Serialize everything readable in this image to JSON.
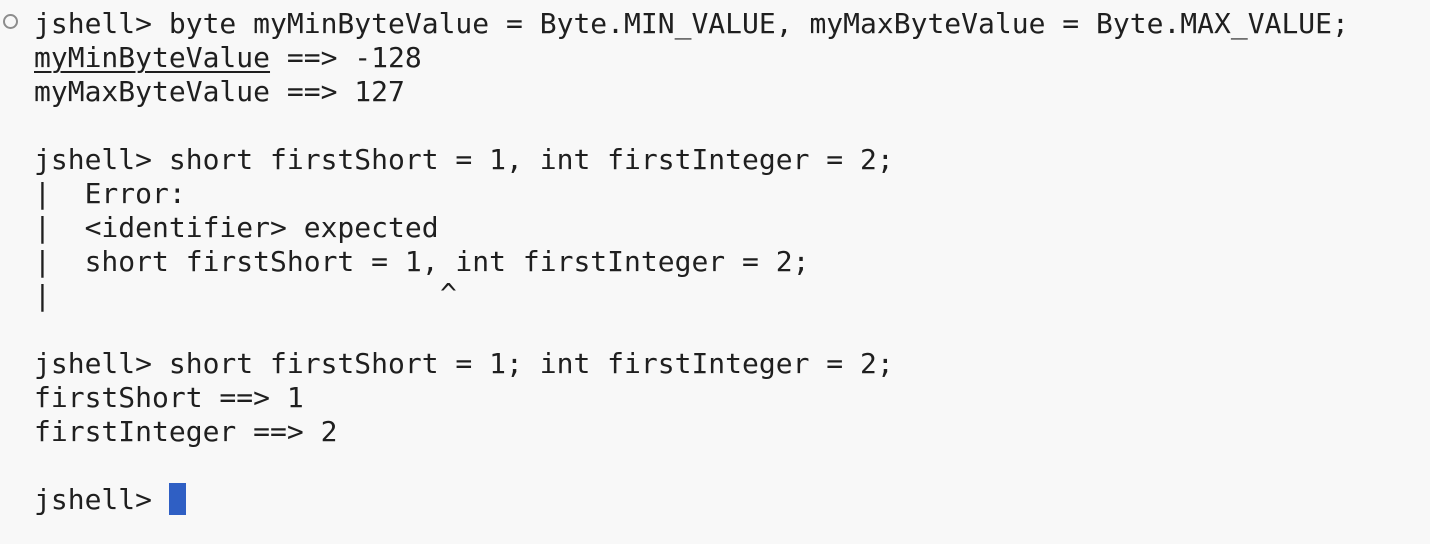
{
  "terminal": {
    "lines": [
      "jshell> byte myMinByteValue = Byte.MIN_VALUE, myMaxByteValue = Byte.MAX_VALUE;",
      "myMinByteValue",
      " ==> -128",
      "myMaxByteValue ==> 127",
      "jshell> short firstShort = 1, int firstInteger = 2;",
      "|  Error:",
      "|  <identifier> expected",
      "|  short firstShort = 1, int firstInteger = 2;",
      "|",
      "^",
      "jshell> short firstShort = 1; int firstInteger = 2;",
      "firstShort ==> 1",
      "firstInteger ==> 2",
      "jshell> "
    ]
  },
  "colors": {
    "background": "#f8f8f8",
    "text": "#1f1f1f",
    "cursor": "#2f5fc4",
    "marker": "#8d8d8d"
  }
}
